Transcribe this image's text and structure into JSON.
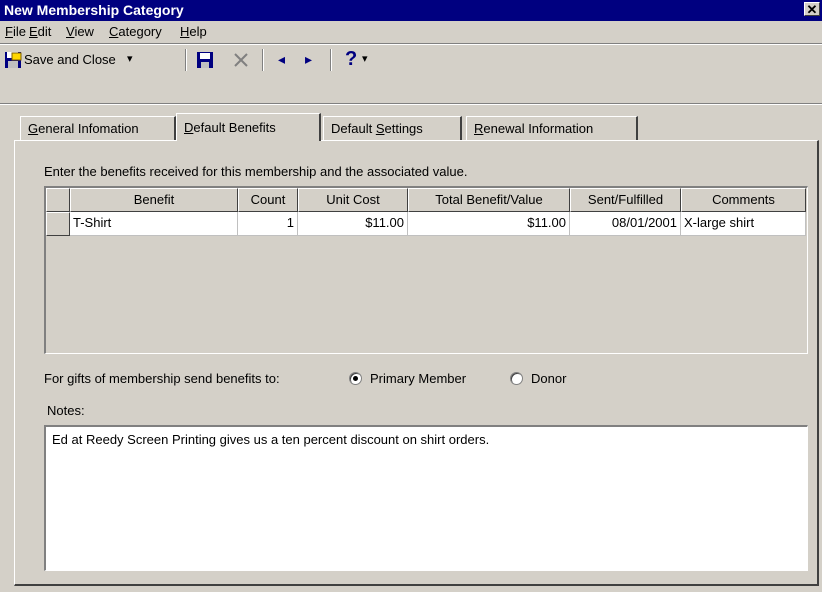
{
  "window": {
    "title": "New Membership Category",
    "close_glyph": "✕"
  },
  "menu": [
    {
      "accel": "F",
      "rest": "ile"
    },
    {
      "accel": "E",
      "rest": "dit"
    },
    {
      "accel": "V",
      "rest": "iew"
    },
    {
      "accel": "C",
      "rest": "ategory"
    },
    {
      "accel": "H",
      "rest": "elp"
    }
  ],
  "toolbar": {
    "save_close_label": "Save and Close",
    "dropdown_glyph": "▾",
    "prev_glyph": "◂",
    "next_glyph": "▸",
    "help_glyph": "?"
  },
  "tabs": [
    {
      "prefix": "",
      "accel": "G",
      "rest": "eneral Infomation"
    },
    {
      "prefix": "",
      "accel": "D",
      "rest": "efault Benefits"
    },
    {
      "prefix": "Default ",
      "accel": "S",
      "rest": "ettings"
    },
    {
      "prefix": "",
      "accel": "R",
      "rest": "enewal Information"
    }
  ],
  "benefits": {
    "instructions": "Enter the benefits received for this membership and the associated value.",
    "columns": [
      "Benefit",
      "Count",
      "Unit Cost",
      "Total Benefit/Value",
      "Sent/Fulfilled",
      "Comments"
    ],
    "rows": [
      {
        "benefit": "T-Shirt",
        "count": "1",
        "unit_cost": "$11.00",
        "total": "$11.00",
        "sent": "08/01/2001",
        "comments": "X-large shirt"
      }
    ]
  },
  "send_benefits": {
    "label": "For gifts of membership send benefits to:",
    "options": [
      "Primary Member",
      "Donor"
    ],
    "selected": "Primary Member"
  },
  "notes": {
    "label": "Notes:",
    "value": "Ed at Reedy Screen Printing gives us a ten percent discount on shirt orders."
  },
  "colors": {
    "title_bar": "#000080",
    "face": "#d4d0c8"
  }
}
